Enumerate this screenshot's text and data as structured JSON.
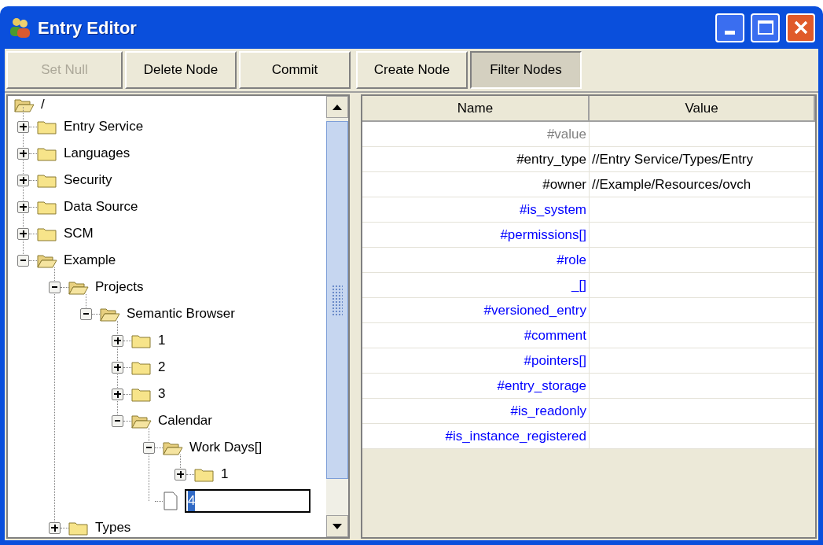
{
  "window": {
    "title": "Entry Editor"
  },
  "toolbar": [
    {
      "label": "Set Null",
      "disabled": true,
      "pressed": false
    },
    {
      "label": "Delete Node",
      "disabled": false,
      "pressed": false
    },
    {
      "label": "Commit",
      "disabled": false,
      "pressed": false
    },
    {
      "label": "Create Node",
      "disabled": false,
      "pressed": false
    },
    {
      "label": "Filter Nodes",
      "disabled": false,
      "pressed": true
    }
  ],
  "tree": {
    "root": {
      "label": "/",
      "kind": "folder",
      "children": [
        {
          "label": "Entry Service",
          "kind": "folder",
          "expanded": false
        },
        {
          "label": "Languages",
          "kind": "folder",
          "expanded": false
        },
        {
          "label": "Security",
          "kind": "folder",
          "expanded": false
        },
        {
          "label": "Data Source",
          "kind": "folder",
          "expanded": false
        },
        {
          "label": "SCM",
          "kind": "folder",
          "expanded": false
        },
        {
          "label": "Example",
          "kind": "folder",
          "expanded": true,
          "children": [
            {
              "label": "Projects",
              "kind": "folder",
              "expanded": true,
              "children": [
                {
                  "label": "Semantic Browser",
                  "kind": "folder",
                  "expanded": true,
                  "children": [
                    {
                      "label": "1",
                      "kind": "folder",
                      "expanded": false
                    },
                    {
                      "label": "2",
                      "kind": "folder",
                      "expanded": false
                    },
                    {
                      "label": "3",
                      "kind": "folder",
                      "expanded": false
                    },
                    {
                      "label": "Calendar",
                      "kind": "folder",
                      "expanded": true,
                      "children": [
                        {
                          "label": "Work Days[]",
                          "kind": "folder",
                          "expanded": true,
                          "children": [
                            {
                              "label": "1",
                              "kind": "folder",
                              "expanded": false
                            }
                          ]
                        },
                        {
                          "label": "4",
                          "kind": "file",
                          "editing": true
                        }
                      ]
                    }
                  ]
                }
              ]
            },
            {
              "label": "Types",
              "kind": "folder",
              "expanded": false
            }
          ]
        }
      ]
    }
  },
  "table": {
    "columns": [
      "Name",
      "Value"
    ],
    "rows": [
      {
        "name": "#value",
        "color": "#808080"
      },
      {
        "name": "#entry_type",
        "value": "//Entry Service/Types/Entry",
        "color": "#000000"
      },
      {
        "name": "#owner",
        "value": "//Example/Resources/ovch",
        "color": "#000000"
      },
      {
        "name": "#is_system",
        "color": "#0000ff"
      },
      {
        "name": "#permissions[]",
        "color": "#0000ff"
      },
      {
        "name": "#role",
        "color": "#0000ff"
      },
      {
        "name": "_[]",
        "color": "#0000ff"
      },
      {
        "name": "#versioned_entry",
        "color": "#0000ff"
      },
      {
        "name": "#comment",
        "color": "#0000ff"
      },
      {
        "name": "#pointers[]",
        "color": "#0000ff"
      },
      {
        "name": "#entry_storage",
        "color": "#0000ff"
      },
      {
        "name": "#is_readonly",
        "color": "#0000ff"
      },
      {
        "name": "#is_instance_registered",
        "color": "#0000ff"
      }
    ]
  }
}
